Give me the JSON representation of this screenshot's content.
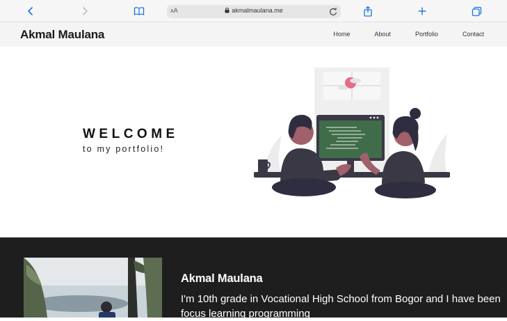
{
  "browser": {
    "aa_label_small": "A",
    "aa_label_large": "A",
    "url": "akmalmaulana.me",
    "icons": [
      "back-icon",
      "forward-icon",
      "bookmarks-icon",
      "lock-icon",
      "reload-icon",
      "share-icon",
      "new-tab-icon",
      "tabs-icon"
    ]
  },
  "site": {
    "brand": "Akmal Maulana",
    "nav": [
      "Home",
      "About",
      "Portfolio",
      "Contact"
    ]
  },
  "hero": {
    "title": "WELCOME",
    "subtitle": "to my portfolio!"
  },
  "about": {
    "name": "Akmal Maulana",
    "description": "I'm 10th grade in Vocational High School from Bogor and I have been focus learning programming"
  },
  "colors": {
    "accent_pink": "#e96a86",
    "screen_green": "#3f6c49",
    "dark_section": "#1e1e1e",
    "figure_dark": "#3b3845",
    "skin_tone": "#a0616a"
  }
}
